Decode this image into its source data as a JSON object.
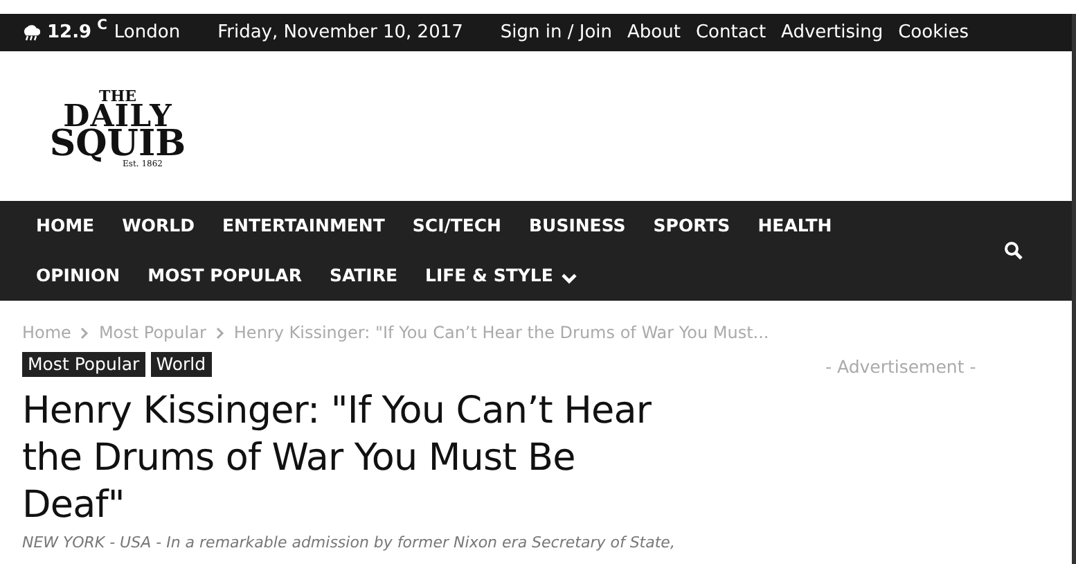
{
  "top_bar": {
    "weather": {
      "temperature": "12.9",
      "unit": "C",
      "city": "London"
    },
    "date": "Friday, November 10, 2017",
    "links": [
      "Sign in / Join",
      "About",
      "Contact",
      "Advertising",
      "Cookies"
    ]
  },
  "logo": {
    "line_1": "THE",
    "line_2": "DAILY",
    "line_3": "SQUIB",
    "tagline": "Est. 1862"
  },
  "nav": {
    "items": [
      {
        "label": "HOME",
        "dropdown": false
      },
      {
        "label": "WORLD",
        "dropdown": false
      },
      {
        "label": "ENTERTAINMENT",
        "dropdown": false
      },
      {
        "label": "SCI/TECH",
        "dropdown": false
      },
      {
        "label": "BUSINESS",
        "dropdown": false
      },
      {
        "label": "SPORTS",
        "dropdown": false
      },
      {
        "label": "HEALTH",
        "dropdown": false
      },
      {
        "label": "OPINION",
        "dropdown": false
      },
      {
        "label": "MOST POPULAR",
        "dropdown": false
      },
      {
        "label": "SATIRE",
        "dropdown": false
      },
      {
        "label": "LIFE & STYLE",
        "dropdown": true
      }
    ]
  },
  "breadcrumb": [
    "Home",
    "Most Popular",
    "Henry Kissinger: \"If You Can’t Hear the Drums of War You Must..."
  ],
  "tags": [
    "Most Popular",
    "World"
  ],
  "article": {
    "title": "Henry Kissinger: \"If You Can’t Hear the Drums of War You Must Be Deaf\"",
    "excerpt": "NEW YORK - USA - In a remarkable admission by former Nixon era Secretary of State,"
  },
  "sidebar": {
    "ad_label": "- Advertisement -"
  }
}
